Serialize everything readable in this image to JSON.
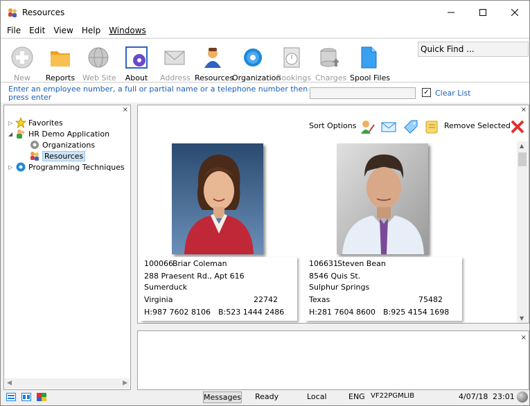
{
  "window": {
    "title": "Resources"
  },
  "menu": [
    "File",
    "Edit",
    "View",
    "Help",
    "Windows"
  ],
  "toolbar": {
    "buttons": [
      {
        "label": "New",
        "icon": "plus-icon",
        "enabled": false
      },
      {
        "label": "Reports",
        "icon": "folder-icon",
        "enabled": true
      },
      {
        "label": "Web Site",
        "icon": "globe-icon",
        "enabled": false
      },
      {
        "label": "About",
        "icon": "about-gear-icon",
        "enabled": true
      },
      {
        "label": "Address",
        "icon": "envelope-icon",
        "enabled": false
      },
      {
        "label": "Resources",
        "icon": "person-icon",
        "enabled": true
      },
      {
        "label": "Organization",
        "icon": "gear-icon",
        "enabled": true
      },
      {
        "label": "Bookings",
        "icon": "clock-icon",
        "enabled": false
      },
      {
        "label": "Charges",
        "icon": "database-icon",
        "enabled": false
      },
      {
        "label": "Spool Files",
        "icon": "document-icon",
        "enabled": true
      }
    ],
    "quick_find": "Quick Find ..."
  },
  "prompt": {
    "text": "Enter an employee number, a full or partial name or a telephone number then press enter",
    "clear_list_label": "Clear List",
    "clear_list_checked": true
  },
  "tree": {
    "close": "×",
    "items": [
      {
        "label": "Favorites",
        "icon": "star-icon"
      },
      {
        "label": "HR Demo Application",
        "icon": "people-icon"
      },
      {
        "label": "Organizations",
        "icon": "small-gear-icon"
      },
      {
        "label": "Resources",
        "icon": "small-people-icon"
      },
      {
        "label": "Programming Techniques",
        "icon": "blue-gear-icon"
      }
    ]
  },
  "main": {
    "close": "×",
    "sort_options_label": "Sort Options",
    "remove_selected_label": "Remove Selected",
    "employees": [
      {
        "id": "100066",
        "name": "Briar Coleman",
        "address": "288 Praesent Rd., Apt 616",
        "city": "Sumerduck",
        "state": "Virginia",
        "zip": "22742",
        "home": "H:987 7602 8106",
        "business": "B:523 1444 2486"
      },
      {
        "id": "106631",
        "name": "Steven Bean",
        "address": "8546 Quis St.",
        "city": "Sulphur Springs",
        "state": "Texas",
        "zip": "75482",
        "home": "H:281 7604 8600",
        "business": "B:925 4154 1698"
      }
    ]
  },
  "messages": {
    "close": "×"
  },
  "status": {
    "messages_button": "Messages",
    "state": "Ready",
    "location": "Local",
    "language": "ENG",
    "library": "VF22PGMLIB",
    "date": "4/07/18",
    "time": "23:01"
  }
}
